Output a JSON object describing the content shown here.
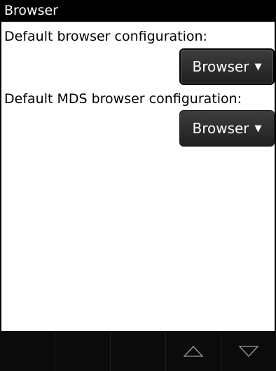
{
  "screen": {
    "title": "Browser"
  },
  "settings": {
    "default_browser": {
      "label": "Default browser configuration:",
      "value": "Browser",
      "arrow": "▼"
    },
    "default_mds_browser": {
      "label": "Default MDS browser configuration:",
      "value": "Browser",
      "arrow": "▼"
    }
  },
  "bottom_bar": {
    "icons": [
      "up-arrow-icon",
      "down-arrow-icon"
    ]
  }
}
